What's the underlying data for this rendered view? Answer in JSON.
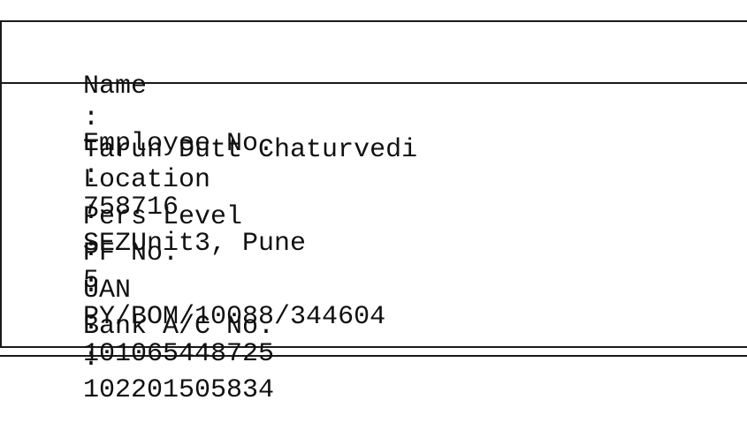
{
  "header": {
    "name_label": "Name",
    "name_sep": ":",
    "name_value": "Tarun Dutt Chaturvedi"
  },
  "details": [
    {
      "label": "Employee No.",
      "sep": ":",
      "value": "758716"
    },
    {
      "label": "Location",
      "sep": ":",
      "value": "SEZUnit3, Pune"
    },
    {
      "label": "Pers Level",
      "sep": ":",
      "value": "5"
    },
    {
      "label": "PF No.",
      "sep": ":",
      "value": "PY/BOM/10088/344604"
    },
    {
      "label": "UAN",
      "sep": ":",
      "value": "101065448725"
    },
    {
      "label": "Bank A/C No.",
      "sep": ":",
      "value": "102201505834"
    }
  ]
}
